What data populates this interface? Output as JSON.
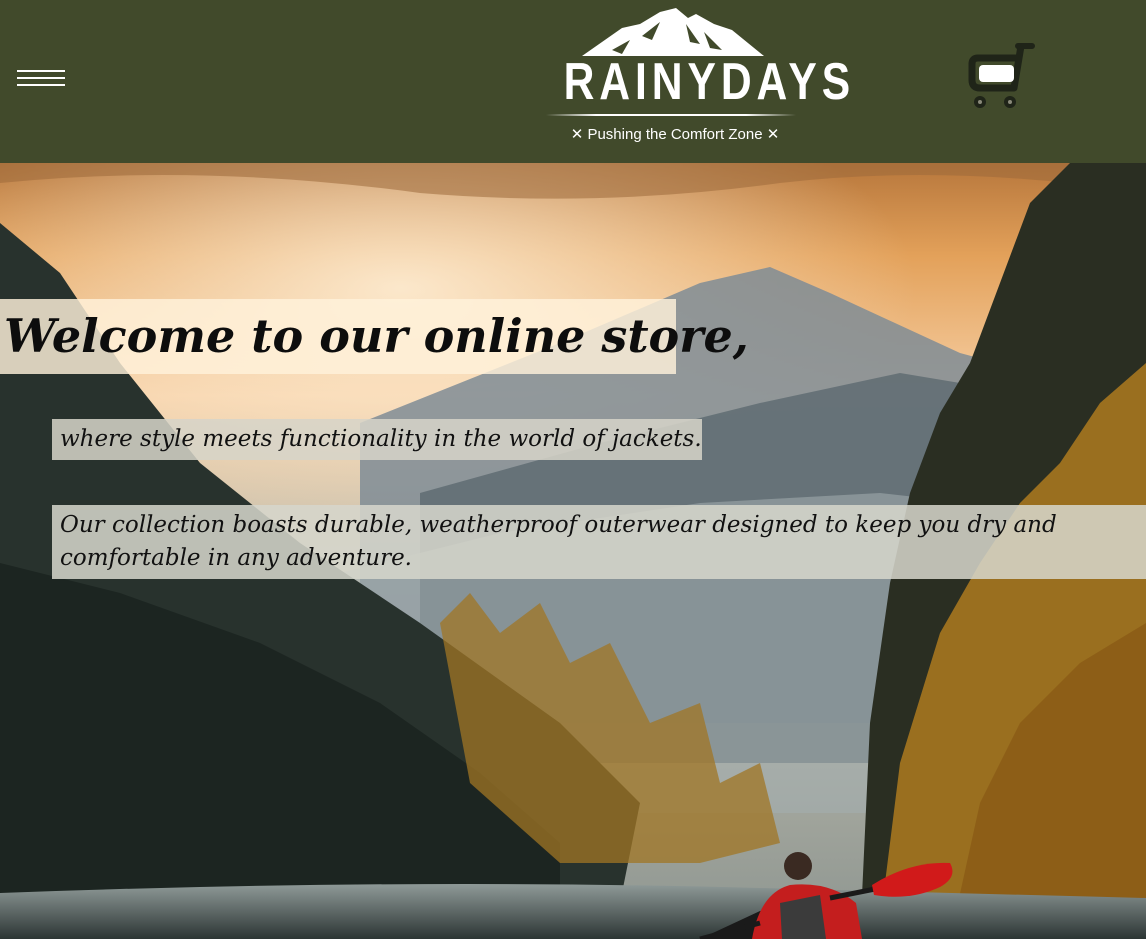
{
  "header": {
    "menu_icon": "hamburger-icon",
    "logo": {
      "wordmark": "RAINYDAYS",
      "tagline": "Pushing the Comfort Zone",
      "tagline_marks": "✕",
      "icon": "mountain-icon"
    },
    "cart_icon": "shopping-cart-icon"
  },
  "hero": {
    "title": "Welcome to our online store,",
    "subtitle": "where style meets functionality in the world of jackets.",
    "body": "Our collection boasts durable, weatherproof outerwear designed to keep you dry and comfortable in any adventure.",
    "background": "kayaker-mountain-lake-photo"
  },
  "colors": {
    "header_bg": "#414a2b",
    "text_light": "#ffffff",
    "paddle_red": "#d11a1a"
  }
}
